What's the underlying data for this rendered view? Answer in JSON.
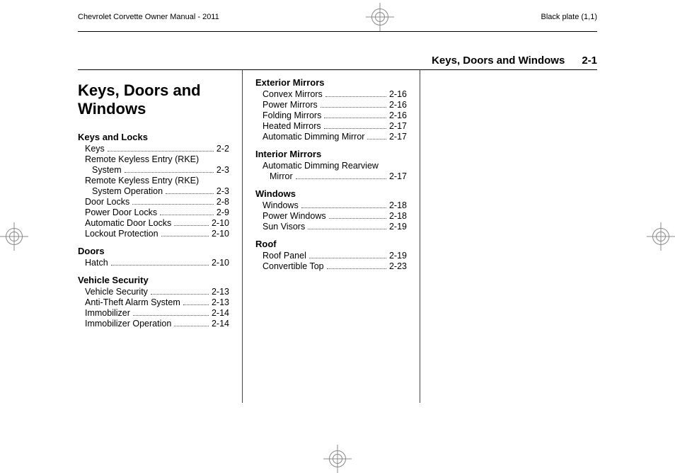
{
  "header": {
    "manual_title": "Chevrolet Corvette Owner Manual - 2011",
    "plate_info": "Black plate (1,1)"
  },
  "running_head": {
    "title": "Keys, Doors and Windows",
    "page_num": "2-1"
  },
  "chapter_title": "Keys, Doors and Windows",
  "col1": [
    {
      "type": "section",
      "text": "Keys and Locks"
    },
    {
      "type": "entry",
      "label": "Keys",
      "page": "2-2"
    },
    {
      "type": "entry_wrap",
      "label_line1": "Remote Keyless Entry (RKE)",
      "label_line2": "System",
      "page": "2-3"
    },
    {
      "type": "entry_wrap",
      "label_line1": "Remote Keyless Entry (RKE)",
      "label_line2": "System Operation",
      "page": "2-3"
    },
    {
      "type": "entry",
      "label": "Door Locks",
      "page": "2-8"
    },
    {
      "type": "entry",
      "label": "Power Door Locks",
      "page": "2-9"
    },
    {
      "type": "entry",
      "label": "Automatic Door Locks",
      "page": "2-10"
    },
    {
      "type": "entry",
      "label": "Lockout Protection",
      "page": "2-10"
    },
    {
      "type": "section",
      "text": "Doors"
    },
    {
      "type": "entry",
      "label": "Hatch",
      "page": "2-10"
    },
    {
      "type": "section",
      "text": "Vehicle Security"
    },
    {
      "type": "entry",
      "label": "Vehicle Security",
      "page": "2-13"
    },
    {
      "type": "entry",
      "label": "Anti-Theft Alarm System",
      "page": "2-13"
    },
    {
      "type": "entry",
      "label": "Immobilizer",
      "page": "2-14"
    },
    {
      "type": "entry",
      "label": "Immobilizer Operation",
      "page": "2-14"
    }
  ],
  "col2": [
    {
      "type": "section",
      "text": "Exterior Mirrors"
    },
    {
      "type": "entry",
      "label": "Convex Mirrors",
      "page": "2-16"
    },
    {
      "type": "entry",
      "label": "Power Mirrors",
      "page": "2-16"
    },
    {
      "type": "entry",
      "label": "Folding Mirrors",
      "page": "2-16"
    },
    {
      "type": "entry",
      "label": "Heated Mirrors",
      "page": "2-17"
    },
    {
      "type": "entry",
      "label": "Automatic Dimming Mirror",
      "page": "2-17"
    },
    {
      "type": "section",
      "text": "Interior Mirrors"
    },
    {
      "type": "entry_wrap",
      "label_line1": "Automatic Dimming Rearview",
      "label_line2": "Mirror",
      "page": "2-17"
    },
    {
      "type": "section",
      "text": "Windows"
    },
    {
      "type": "entry",
      "label": "Windows",
      "page": "2-18"
    },
    {
      "type": "entry",
      "label": "Power Windows",
      "page": "2-18"
    },
    {
      "type": "entry",
      "label": "Sun Visors",
      "page": "2-19"
    },
    {
      "type": "section",
      "text": "Roof"
    },
    {
      "type": "entry",
      "label": "Roof Panel",
      "page": "2-19"
    },
    {
      "type": "entry",
      "label": "Convertible Top",
      "page": "2-23"
    }
  ]
}
